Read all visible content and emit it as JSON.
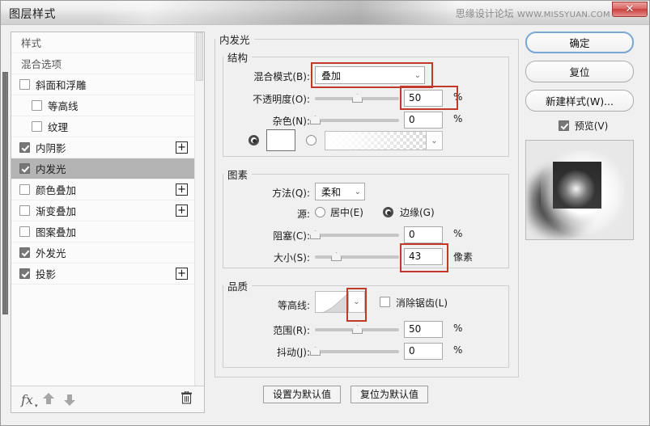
{
  "window": {
    "title": "图层样式",
    "watermark_text": "思缘设计论坛",
    "watermark_url": "WWW.MISSYUAN.COM",
    "close_glyph": "✕"
  },
  "styles_panel": {
    "items": [
      {
        "label": "样式",
        "type": "header",
        "checked": null,
        "has_plus": false,
        "selected": false,
        "sub": false
      },
      {
        "label": "混合选项",
        "type": "header",
        "checked": null,
        "has_plus": false,
        "selected": false,
        "sub": false
      },
      {
        "label": "斜面和浮雕",
        "type": "item",
        "checked": false,
        "has_plus": false,
        "selected": false,
        "sub": false
      },
      {
        "label": "等高线",
        "type": "item",
        "checked": false,
        "has_plus": false,
        "selected": false,
        "sub": true
      },
      {
        "label": "纹理",
        "type": "item",
        "checked": false,
        "has_plus": false,
        "selected": false,
        "sub": true
      },
      {
        "label": "内阴影",
        "type": "item",
        "checked": true,
        "has_plus": true,
        "selected": false,
        "sub": false
      },
      {
        "label": "内发光",
        "type": "item",
        "checked": true,
        "has_plus": false,
        "selected": true,
        "sub": false
      },
      {
        "label": "颜色叠加",
        "type": "item",
        "checked": false,
        "has_plus": true,
        "selected": false,
        "sub": false
      },
      {
        "label": "渐变叠加",
        "type": "item",
        "checked": false,
        "has_plus": true,
        "selected": false,
        "sub": false
      },
      {
        "label": "图案叠加",
        "type": "item",
        "checked": false,
        "has_plus": false,
        "selected": false,
        "sub": false
      },
      {
        "label": "外发光",
        "type": "item",
        "checked": true,
        "has_plus": false,
        "selected": false,
        "sub": false
      },
      {
        "label": "投影",
        "type": "item",
        "checked": true,
        "has_plus": true,
        "selected": false,
        "sub": false
      }
    ],
    "toolbar": {
      "fx_label": "fx",
      "fx_caret": "▾",
      "move_up_name": "arrow-up",
      "move_down_name": "arrow-down",
      "trash_glyph": "🗑"
    }
  },
  "options": {
    "section_title": "内发光",
    "structure": {
      "title": "结构",
      "blend_mode": {
        "label": "混合模式(B):",
        "value": "叠加",
        "chevron": "⌄"
      },
      "opacity": {
        "label": "不透明度(O):",
        "value": "50",
        "unit": "%",
        "slider_pct": 50
      },
      "noise": {
        "label": "杂色(N):",
        "value": "0",
        "unit": "%",
        "slider_pct": 0
      },
      "fill_color_selected": true,
      "color_value": "#ffffff",
      "gradient_chevron": "⌄"
    },
    "elements": {
      "title": "图素",
      "technique": {
        "label": "方法(Q):",
        "value": "柔和",
        "chevron": "⌄"
      },
      "source": {
        "label": "源:",
        "center_label": "居中(E)",
        "edge_label": "边缘(G)",
        "selected": "edge"
      },
      "choke": {
        "label": "阻塞(C):",
        "value": "0",
        "unit": "%",
        "slider_pct": 0
      },
      "size": {
        "label": "大小(S):",
        "value": "43",
        "unit": "像素",
        "slider_pct": 25
      }
    },
    "quality": {
      "title": "品质",
      "contour": {
        "label": "等高线:",
        "chevron": "⌄"
      },
      "anti_alias": {
        "label": "消除锯齿(L)",
        "checked": false
      },
      "range": {
        "label": "范围(R):",
        "value": "50",
        "unit": "%",
        "slider_pct": 50
      },
      "jitter": {
        "label": "抖动(J):",
        "value": "0",
        "unit": "%",
        "slider_pct": 0
      }
    },
    "make_default_label": "设置为默认值",
    "reset_default_label": "复位为默认值"
  },
  "right_panel": {
    "ok_label": "确定",
    "reset_label": "复位",
    "new_style_label": "新建样式(W)...",
    "preview_label": "预览(V)",
    "preview_checked": true
  },
  "colors": {
    "annotation_red": "#c0392b",
    "selection_gray": "#b4b4b4",
    "focus_blue": "#7aa7d4",
    "dialog_bg": "#f0f0f0"
  }
}
